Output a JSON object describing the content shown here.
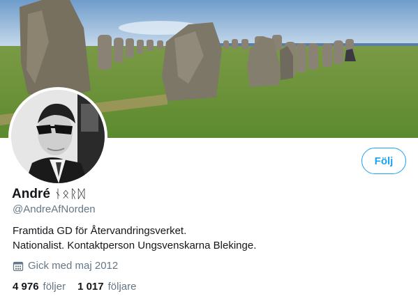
{
  "profile": {
    "display_name": "André",
    "name_runes": "ᚾᛟᚱᛞ",
    "handle": "@AndreAfNorden",
    "bio_lines": [
      "Framtida GD för Återvandringsverket.",
      "Nationalist. Kontaktperson Ungsvenskarna Blekinge."
    ],
    "joined": "Gick med maj 2012",
    "joined_icon": "calendar-icon"
  },
  "actions": {
    "follow_label": "Följ"
  },
  "stats": {
    "following_count": "4 976",
    "following_label": "följer",
    "followers_count": "1 017",
    "followers_label": "följare"
  },
  "colors": {
    "accent": "#1da1f2",
    "secondary_text": "#657786",
    "primary_text": "#14171a"
  }
}
